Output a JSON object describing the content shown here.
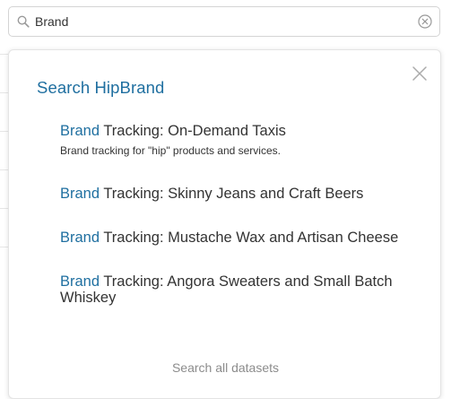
{
  "search": {
    "value": "Brand",
    "placeholder": ""
  },
  "panel": {
    "title": "Search HipBrand",
    "results": [
      {
        "highlight": "Brand",
        "rest": " Tracking: On-Demand Taxis",
        "description": "Brand tracking for \"hip\" products and services."
      },
      {
        "highlight": "Brand",
        "rest": " Tracking: Skinny Jeans and Craft Beers",
        "description": ""
      },
      {
        "highlight": "Brand",
        "rest": " Tracking: Mustache Wax and Artisan Cheese",
        "description": ""
      },
      {
        "highlight": "Brand",
        "rest": " Tracking: Angora Sweaters and Small Batch Whiskey",
        "description": ""
      }
    ],
    "search_all_label": "Search all datasets"
  },
  "colors": {
    "accent": "#1f6fa0",
    "muted": "#8c8c8c"
  },
  "icons": {
    "search": "search-icon",
    "clear": "clear-icon",
    "close": "close-icon"
  }
}
